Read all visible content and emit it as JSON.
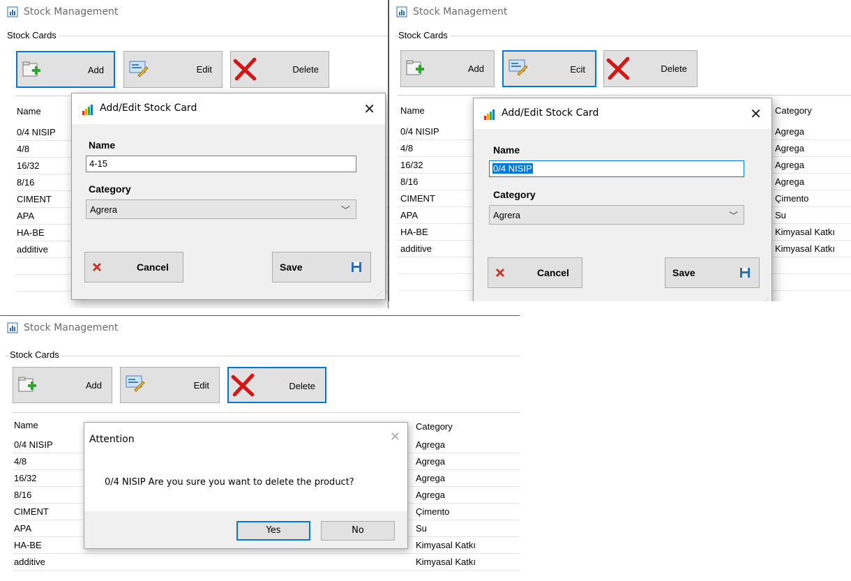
{
  "window_title": "Stock Management",
  "group_title": "Stock Cards",
  "toolbar": {
    "add": "Add",
    "edit": "Edit",
    "delete": "Delete"
  },
  "panel2_toolbar": {
    "edit": "Ecit"
  },
  "columns": {
    "name": "Name",
    "category": "Category"
  },
  "rows_panel1": [
    "0/4 NISIP",
    "4/8",
    "16/32",
    "8/16",
    "CIMENT",
    "APA",
    "HA-BE",
    "additive"
  ],
  "rows": [
    {
      "name": "0/4 NISIP",
      "category": "Agrega"
    },
    {
      "name": "4/8",
      "category": "Agrega"
    },
    {
      "name": "16/32",
      "category": "Agrega"
    },
    {
      "name": "8/16",
      "category": "Agrega"
    },
    {
      "name": "CIMENT",
      "category": "Çimento"
    },
    {
      "name": "APA",
      "category": "Su"
    },
    {
      "name": "HA-BE",
      "category": "Kimyasal Katkı"
    },
    {
      "name": "additive",
      "category": "Kimyasal Katkı"
    }
  ],
  "dialog_add": {
    "title": "Add/Edit Stock Card",
    "name_label": "Name",
    "name_value": "4-15",
    "category_label": "Category",
    "category_value": "Agrera",
    "cancel": "Cancel",
    "save": "Save"
  },
  "dialog_edit": {
    "title": "Add/Edit Stock Card",
    "name_label": "Name",
    "name_value": "0/4 NISIP",
    "category_label": "Category",
    "category_value": "Agrera",
    "cancel": "Cancel",
    "save": "Save"
  },
  "confirm": {
    "title": "Attention",
    "message": "0/4 NISIP Are you sure you want to delete the product?",
    "yes": "Yes",
    "no": "No"
  },
  "colors": {
    "focus": "#0078d7",
    "button_face": "#e1e1e1",
    "dialog_bg": "#f0f0f0"
  },
  "icons": {
    "app": "bar-chart-icon",
    "add": "folder-add-icon",
    "edit": "edit-card-icon",
    "delete": "red-x-icon",
    "save": "floppy-disk-icon"
  }
}
